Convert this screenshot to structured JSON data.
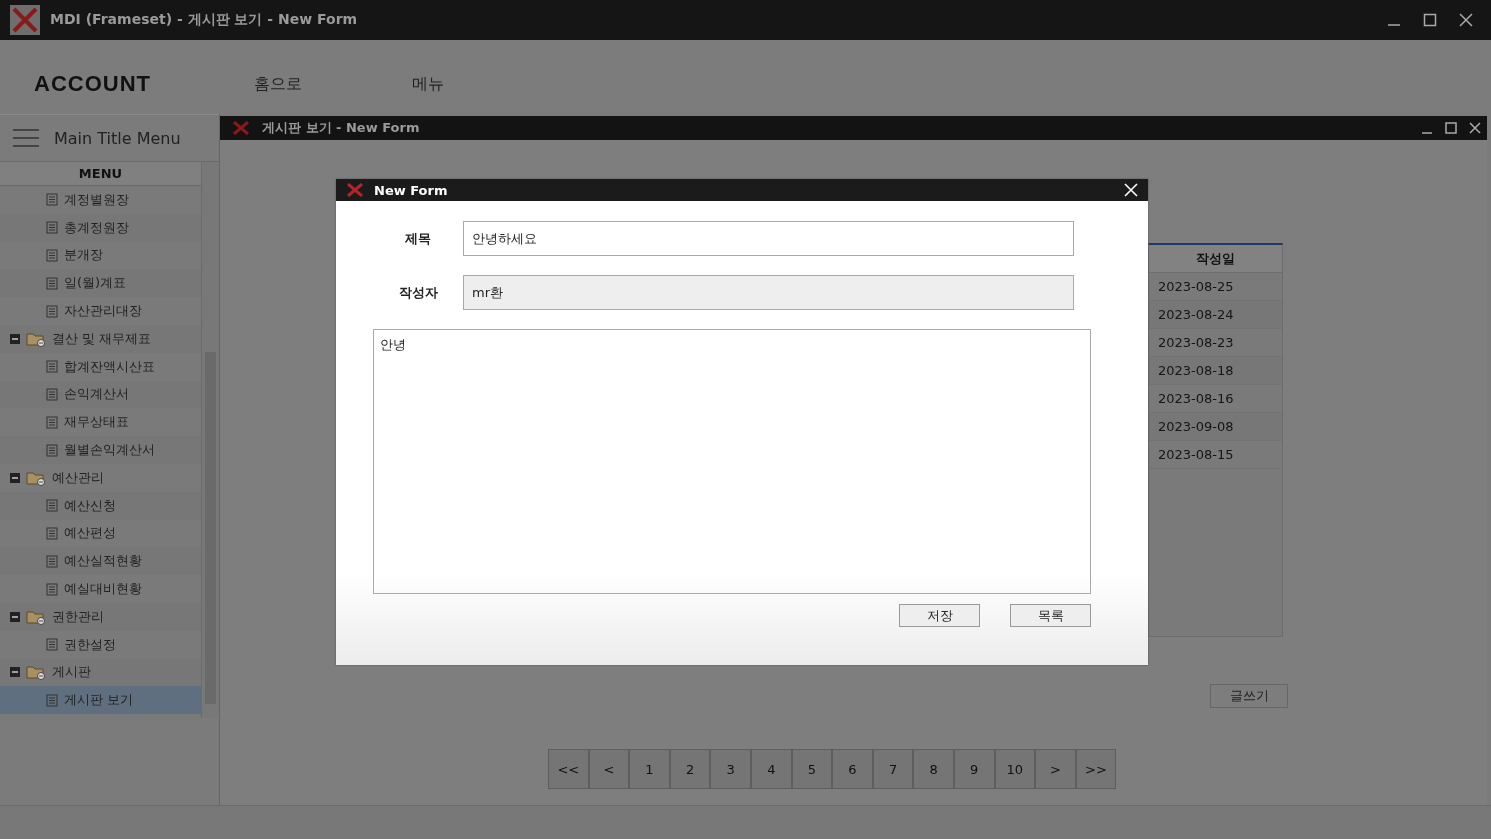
{
  "window": {
    "title": "MDI (Frameset) - 게시판 보기 - New Form"
  },
  "header": {
    "brand": "ACCOUNT",
    "nav": [
      {
        "label": "홈으로"
      },
      {
        "label": "메뉴"
      }
    ]
  },
  "sidebar": {
    "title": "Main Title Menu",
    "heading": "MENU",
    "tree": [
      {
        "children": [
          {
            "label": "계정별원장",
            "selected": false
          },
          {
            "label": "총계정원장",
            "selected": false
          },
          {
            "label": "분개장",
            "selected": false
          },
          {
            "label": "일(월)계표",
            "selected": false
          },
          {
            "label": "자산관리대장",
            "selected": false
          }
        ]
      },
      {
        "label": "결산 및 재무제표",
        "expanded": true,
        "selected": false,
        "children": [
          {
            "label": "합계잔액시산표",
            "selected": false
          },
          {
            "label": "손익계산서",
            "selected": false
          },
          {
            "label": "재무상태표",
            "selected": false
          },
          {
            "label": "월별손익계산서",
            "selected": false
          }
        ]
      },
      {
        "label": "예산관리",
        "expanded": true,
        "selected": false,
        "children": [
          {
            "label": "예산신청",
            "selected": false
          },
          {
            "label": "예산편성",
            "selected": false
          },
          {
            "label": "예산실적현황",
            "selected": false
          },
          {
            "label": "예실대비현황",
            "selected": false
          }
        ]
      },
      {
        "label": "권한관리",
        "expanded": true,
        "selected": false,
        "children": [
          {
            "label": "권한설정",
            "selected": false
          }
        ]
      },
      {
        "label": "게시판",
        "expanded": true,
        "selected": false,
        "children": [
          {
            "label": "게시판 보기",
            "selected": true
          }
        ]
      }
    ]
  },
  "child_window": {
    "title": "게시판 보기 - New Form",
    "table": {
      "columns": [
        "작성일"
      ],
      "rows": [
        [
          "2023-08-25"
        ],
        [
          "2023-08-24"
        ],
        [
          "2023-08-23"
        ],
        [
          "2023-08-18"
        ],
        [
          "2023-08-16"
        ],
        [
          "2023-09-08"
        ],
        [
          "2023-08-15"
        ]
      ]
    },
    "write_button": "글쓰기",
    "pagination": [
      {
        "label": "<<",
        "selected": false
      },
      {
        "label": "<",
        "selected": false
      },
      {
        "label": "1",
        "selected": false
      },
      {
        "label": "2",
        "selected": false
      },
      {
        "label": "3",
        "selected": false
      },
      {
        "label": "4",
        "selected": false
      },
      {
        "label": "5",
        "selected": false
      },
      {
        "label": "6",
        "selected": false
      },
      {
        "label": "7",
        "selected": false
      },
      {
        "label": "8",
        "selected": false
      },
      {
        "label": "9",
        "selected": false
      },
      {
        "label": "10",
        "selected": false
      },
      {
        "label": ">",
        "selected": false
      },
      {
        "label": ">>",
        "selected": false
      }
    ]
  },
  "dialog": {
    "title": "New Form",
    "fields": [
      {
        "label": "제목",
        "value": "안녕하세요",
        "disabled": false
      },
      {
        "label": "작성자",
        "value": "mr환",
        "disabled": true
      }
    ],
    "content": "안녕",
    "buttons": [
      "저장",
      "목록"
    ]
  }
}
